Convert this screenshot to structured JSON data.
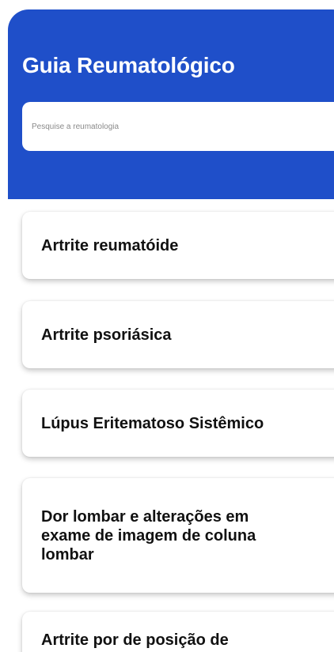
{
  "header": {
    "title": "Guia Reumatológico"
  },
  "search": {
    "placeholder": "Pesquise a reumatologia",
    "value": ""
  },
  "topics": [
    {
      "label": "Artrite reumatóide"
    },
    {
      "label": "Artrite psoriásica"
    },
    {
      "label": "Lúpus Eritematoso Sistêmico"
    },
    {
      "label": "Dor lombar e alterações em exame de imagem de coluna lombar"
    },
    {
      "label": "Artrite por de posição de"
    }
  ],
  "colors": {
    "header_background": "#1f4fc9",
    "header_text": "#ffffff",
    "card_background": "#ffffff",
    "card_text": "#111111"
  }
}
